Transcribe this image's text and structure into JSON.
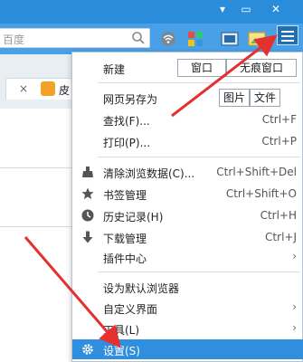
{
  "window_controls": {
    "minimize": "▾",
    "restore": "▭",
    "close": "✕"
  },
  "search": {
    "placeholder": "百度"
  },
  "tab": {
    "close": "×",
    "label": "皮"
  },
  "menu": {
    "new": {
      "label": "新建",
      "window": "窗口",
      "incognito": "无痕窗口"
    },
    "save_as": {
      "label": "网页另存为",
      "image": "图片",
      "file": "文件"
    },
    "find": {
      "label": "查找(F)...",
      "shortcut": "Ctrl+F"
    },
    "print": {
      "label": "打印(P)...",
      "shortcut": "Ctrl+P"
    },
    "clear": {
      "label": "清除浏览数据(C)...",
      "shortcut": "Ctrl+Shift+Del"
    },
    "bookmarks": {
      "label": "书签管理",
      "shortcut": "Ctrl+Shift+O"
    },
    "history": {
      "label": "历史记录(H)",
      "shortcut": "Ctrl+H"
    },
    "downloads": {
      "label": "下载管理",
      "shortcut": "Ctrl+J"
    },
    "plugins": {
      "label": "插件中心"
    },
    "default_browser": {
      "label": "设为默认浏览器"
    },
    "customize": {
      "label": "自定义界面"
    },
    "tools": {
      "label": "工具(L)"
    },
    "settings": {
      "label": "设置(S)"
    }
  },
  "colors": {
    "accent": "#2f8fde",
    "annotation": "#e53030"
  },
  "icons": [
    "search-icon",
    "wifi-icon",
    "apps-grid-icon",
    "screenshot-icon",
    "image-icon",
    "hamburger-menu-icon",
    "broom-icon",
    "star-icon",
    "clock-icon",
    "download-arrow-icon",
    "gear-icon"
  ]
}
